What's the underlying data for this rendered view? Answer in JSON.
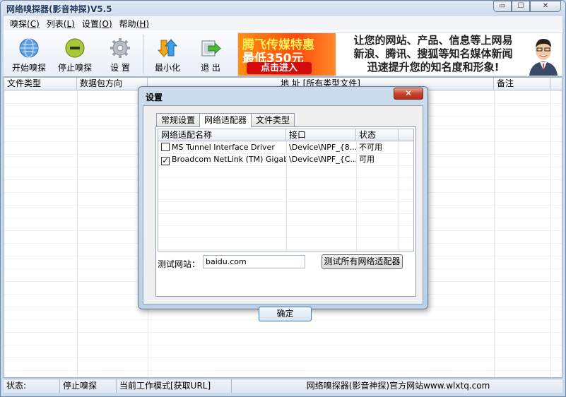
{
  "window": {
    "title": "网络嗅探器(影音神探)V5.5",
    "min_glyph": "▭",
    "max_glyph": "☐",
    "close_glyph": "✕"
  },
  "menu": [
    {
      "label": "嗅探",
      "accel": "(C)"
    },
    {
      "label": "列表",
      "accel": "(L)"
    },
    {
      "label": "设置",
      "accel": "(O)"
    },
    {
      "label": "帮助",
      "accel": "(H)"
    }
  ],
  "toolbar": {
    "start_label": "开始嗅探",
    "stop_label": "停止嗅探",
    "settings_label": "设 置",
    "minimize_label": "最小化",
    "exit_label": "退 出",
    "start_icon": "globe-icon",
    "stop_icon": "minus-circle-icon",
    "settings_icon": "gear-icon",
    "minimize_icon": "arrows-down-icon",
    "exit_icon": "exit-arrow-icon"
  },
  "banner": {
    "line1": "腾飞传媒特惠",
    "line2": "最低350元",
    "cta": "点击进入",
    "right_line1": "让您的网站、产品、信息等上网易",
    "right_line2": "新浪、腾讯、搜狐等知名媒体新闻",
    "right_line3": "迅速提升您的知名度和形象!",
    "accent_color": "#ff5a0a"
  },
  "table": {
    "columns": [
      "文件类型",
      "数据包方向",
      "地  址 [所有类型文件]",
      "备注"
    ]
  },
  "status": {
    "label": "状态:",
    "state": "停止嗅探",
    "mode": "当前工作模式[获取URL]",
    "site": "网络嗅探器(影音神探)官方网站www.wlxtq.com"
  },
  "dialog": {
    "title": "设置",
    "close_glyph": "✕",
    "tabs": [
      "常规设置",
      "网络适配器",
      "文件类型"
    ],
    "active_tab": 1,
    "adapter_columns": [
      "网络适配名称",
      "接口",
      "状态"
    ],
    "adapters": [
      {
        "checked": false,
        "name": "MS Tunnel Interface Driver",
        "iface": "\\Device\\NPF_{8...",
        "status": "不可用"
      },
      {
        "checked": true,
        "name": "Broadcom NetLink (TM) Gigabit...",
        "iface": "\\Device\\NPF_{C...",
        "status": "可用"
      }
    ],
    "test_label": "测试网站：",
    "test_value": "baidu.com",
    "test_button": "测试所有网络适配器",
    "ok_button": "确定"
  }
}
